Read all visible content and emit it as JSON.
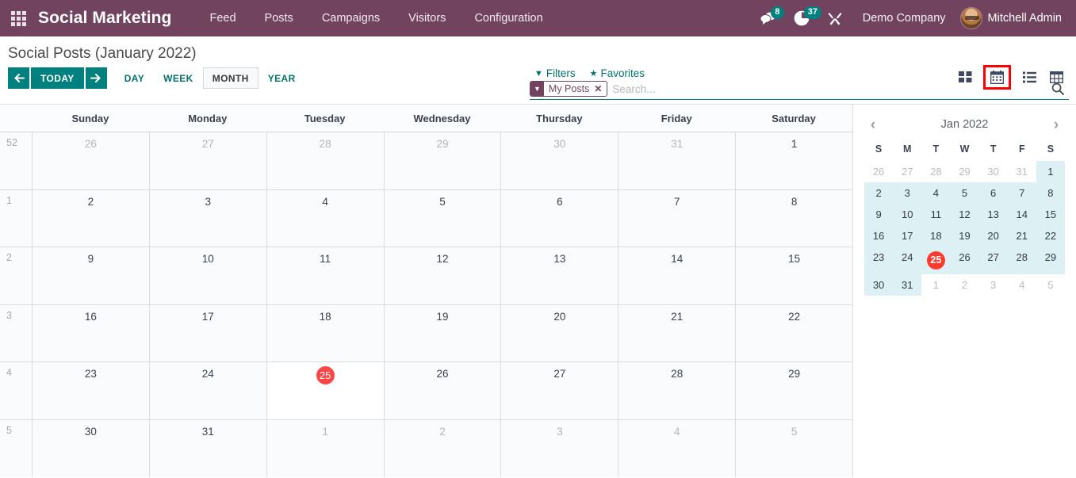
{
  "navbar": {
    "apps_icon": "apps-grid-icon",
    "brand": "Social Marketing",
    "menu": [
      {
        "label": "Feed"
      },
      {
        "label": "Posts"
      },
      {
        "label": "Campaigns"
      },
      {
        "label": "Visitors"
      },
      {
        "label": "Configuration"
      }
    ],
    "messages_icon": "chat-bubble-icon",
    "messages_count": "8",
    "activities_icon": "clock-icon",
    "activities_count": "37",
    "debug_icon": "tools-icon",
    "company": "Demo Company",
    "user": "Mitchell Admin",
    "avatar_icon": "user-avatar",
    "brand_color": "#71435f",
    "accent_color": "#00807e"
  },
  "control_panel": {
    "title": "Social Posts (January 2022)",
    "nav": {
      "prev_icon": "arrow-left-icon",
      "today_label": "TODAY",
      "next_icon": "arrow-right-icon"
    },
    "scales": [
      {
        "label": "DAY",
        "active": false
      },
      {
        "label": "WEEK",
        "active": false
      },
      {
        "label": "MONTH",
        "active": true
      },
      {
        "label": "YEAR",
        "active": false
      }
    ],
    "search": {
      "facet_label": "My Posts",
      "facet_icon": "filter-icon",
      "facet_close_icon": "close-icon",
      "placeholder": "Search...",
      "value": "",
      "magnifier_icon": "search-icon"
    },
    "filters_label": "Filters",
    "filters_icon": "filter-icon",
    "favorites_label": "Favorites",
    "favorites_icon": "star-icon",
    "views": [
      {
        "name": "kanban-view",
        "icon": "kanban-icon",
        "active": false
      },
      {
        "name": "calendar-view",
        "icon": "calendar-icon",
        "active": true
      },
      {
        "name": "list-view",
        "icon": "list-icon",
        "active": false
      },
      {
        "name": "pivot-view",
        "icon": "pivot-icon",
        "active": false
      }
    ],
    "highlight_color": "#ff0000"
  },
  "calendar": {
    "day_headers": [
      "Sunday",
      "Monday",
      "Tuesday",
      "Wednesday",
      "Thursday",
      "Friday",
      "Saturday"
    ],
    "weeks": [
      {
        "week_number": "52",
        "days": [
          {
            "num": "26",
            "other": true,
            "today": false
          },
          {
            "num": "27",
            "other": true,
            "today": false
          },
          {
            "num": "28",
            "other": true,
            "today": false
          },
          {
            "num": "29",
            "other": true,
            "today": false
          },
          {
            "num": "30",
            "other": true,
            "today": false
          },
          {
            "num": "31",
            "other": true,
            "today": false
          },
          {
            "num": "1",
            "other": false,
            "today": false
          }
        ]
      },
      {
        "week_number": "1",
        "days": [
          {
            "num": "2",
            "other": false,
            "today": false
          },
          {
            "num": "3",
            "other": false,
            "today": false
          },
          {
            "num": "4",
            "other": false,
            "today": false
          },
          {
            "num": "5",
            "other": false,
            "today": false
          },
          {
            "num": "6",
            "other": false,
            "today": false
          },
          {
            "num": "7",
            "other": false,
            "today": false
          },
          {
            "num": "8",
            "other": false,
            "today": false
          }
        ]
      },
      {
        "week_number": "2",
        "days": [
          {
            "num": "9",
            "other": false,
            "today": false
          },
          {
            "num": "10",
            "other": false,
            "today": false
          },
          {
            "num": "11",
            "other": false,
            "today": false
          },
          {
            "num": "12",
            "other": false,
            "today": false
          },
          {
            "num": "13",
            "other": false,
            "today": false
          },
          {
            "num": "14",
            "other": false,
            "today": false
          },
          {
            "num": "15",
            "other": false,
            "today": false
          }
        ]
      },
      {
        "week_number": "3",
        "days": [
          {
            "num": "16",
            "other": false,
            "today": false
          },
          {
            "num": "17",
            "other": false,
            "today": false
          },
          {
            "num": "18",
            "other": false,
            "today": false
          },
          {
            "num": "19",
            "other": false,
            "today": false
          },
          {
            "num": "20",
            "other": false,
            "today": false
          },
          {
            "num": "21",
            "other": false,
            "today": false
          },
          {
            "num": "22",
            "other": false,
            "today": false
          }
        ]
      },
      {
        "week_number": "4",
        "days": [
          {
            "num": "23",
            "other": false,
            "today": false
          },
          {
            "num": "24",
            "other": false,
            "today": false
          },
          {
            "num": "25",
            "other": false,
            "today": true
          },
          {
            "num": "26",
            "other": false,
            "today": false
          },
          {
            "num": "27",
            "other": false,
            "today": false
          },
          {
            "num": "28",
            "other": false,
            "today": false
          },
          {
            "num": "29",
            "other": false,
            "today": false
          }
        ]
      },
      {
        "week_number": "5",
        "days": [
          {
            "num": "30",
            "other": false,
            "today": false
          },
          {
            "num": "31",
            "other": false,
            "today": false
          },
          {
            "num": "1",
            "other": true,
            "today": false
          },
          {
            "num": "2",
            "other": true,
            "today": false
          },
          {
            "num": "3",
            "other": true,
            "today": false
          },
          {
            "num": "4",
            "other": true,
            "today": false
          },
          {
            "num": "5",
            "other": true,
            "today": false
          }
        ]
      }
    ]
  },
  "mini_calendar": {
    "title": "Jan 2022",
    "prev_icon": "chevron-left-icon",
    "next_icon": "chevron-right-icon",
    "dow": [
      "S",
      "M",
      "T",
      "W",
      "T",
      "F",
      "S"
    ],
    "highlight_color": "#ddf1f5",
    "today_color": "#ff3b30",
    "days": [
      {
        "num": "26",
        "in": false,
        "today": false
      },
      {
        "num": "27",
        "in": false,
        "today": false
      },
      {
        "num": "28",
        "in": false,
        "today": false
      },
      {
        "num": "29",
        "in": false,
        "today": false
      },
      {
        "num": "30",
        "in": false,
        "today": false
      },
      {
        "num": "31",
        "in": false,
        "today": false
      },
      {
        "num": "1",
        "in": true,
        "today": false
      },
      {
        "num": "2",
        "in": true,
        "today": false
      },
      {
        "num": "3",
        "in": true,
        "today": false
      },
      {
        "num": "4",
        "in": true,
        "today": false
      },
      {
        "num": "5",
        "in": true,
        "today": false
      },
      {
        "num": "6",
        "in": true,
        "today": false
      },
      {
        "num": "7",
        "in": true,
        "today": false
      },
      {
        "num": "8",
        "in": true,
        "today": false
      },
      {
        "num": "9",
        "in": true,
        "today": false
      },
      {
        "num": "10",
        "in": true,
        "today": false
      },
      {
        "num": "11",
        "in": true,
        "today": false
      },
      {
        "num": "12",
        "in": true,
        "today": false
      },
      {
        "num": "13",
        "in": true,
        "today": false
      },
      {
        "num": "14",
        "in": true,
        "today": false
      },
      {
        "num": "15",
        "in": true,
        "today": false
      },
      {
        "num": "16",
        "in": true,
        "today": false
      },
      {
        "num": "17",
        "in": true,
        "today": false
      },
      {
        "num": "18",
        "in": true,
        "today": false
      },
      {
        "num": "19",
        "in": true,
        "today": false
      },
      {
        "num": "20",
        "in": true,
        "today": false
      },
      {
        "num": "21",
        "in": true,
        "today": false
      },
      {
        "num": "22",
        "in": true,
        "today": false
      },
      {
        "num": "23",
        "in": true,
        "today": false
      },
      {
        "num": "24",
        "in": true,
        "today": false
      },
      {
        "num": "25",
        "in": true,
        "today": true
      },
      {
        "num": "26",
        "in": true,
        "today": false
      },
      {
        "num": "27",
        "in": true,
        "today": false
      },
      {
        "num": "28",
        "in": true,
        "today": false
      },
      {
        "num": "29",
        "in": true,
        "today": false
      },
      {
        "num": "30",
        "in": true,
        "today": false
      },
      {
        "num": "31",
        "in": true,
        "today": false
      },
      {
        "num": "1",
        "in": false,
        "today": false
      },
      {
        "num": "2",
        "in": false,
        "today": false
      },
      {
        "num": "3",
        "in": false,
        "today": false
      },
      {
        "num": "4",
        "in": false,
        "today": false
      },
      {
        "num": "5",
        "in": false,
        "today": false
      }
    ]
  }
}
